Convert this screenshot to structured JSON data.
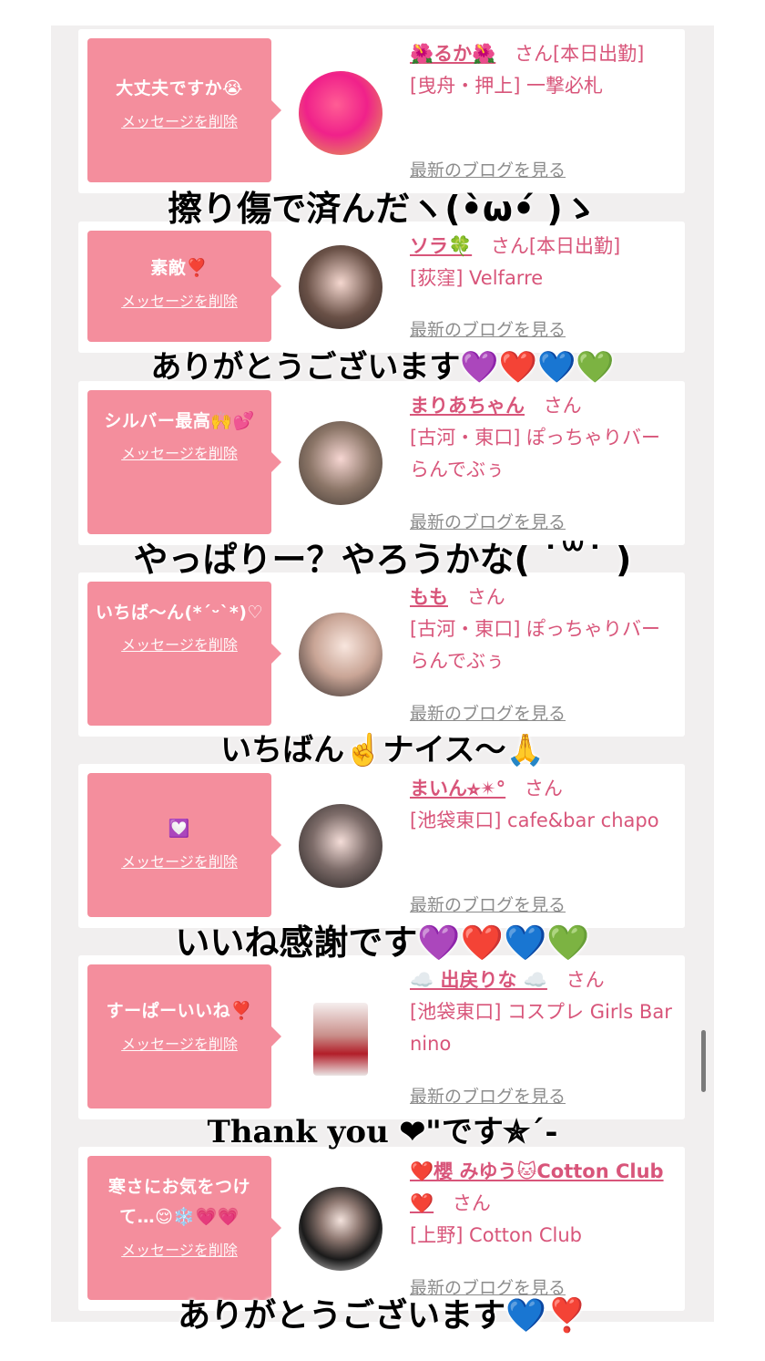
{
  "delete_label": "メッセージを削除",
  "blog_label": "最新のブログを見る",
  "san": "さん",
  "entries": [
    {
      "message": "大丈夫ですか😭",
      "name": "🌺るか🌺",
      "san_line": "さん[本日出勤]",
      "shop": "[曳舟・押上] 一撃必札",
      "caption": "擦り傷で済んだヽ(•̀ω•́ )ゝ"
    },
    {
      "message": "素敵❣️",
      "name": "ソラ🍀",
      "san_line": "さん[本日出勤]",
      "shop": "[荻窪] Velfarre",
      "caption": "ありがとうございます💜❤️💙💚"
    },
    {
      "message": "シルバー最高🙌💕",
      "name": "まりあちゃん",
      "san_line": "さん",
      "shop": "[古河・東口] ぽっちゃりバー らんでぶぅ",
      "caption": "やっぱりー？やろうかな( ˙꒳˙ )"
    },
    {
      "message": "いちば〜ん(*´ᵕ`*)♡",
      "name": "もも",
      "san_line": "さん",
      "shop": "[古河・東口] ぽっちゃりバー らんでぶぅ",
      "caption": "いちばん☝️ナイス〜🙏"
    },
    {
      "message": "💟",
      "name": "まいん⭐︎✴︎°",
      "san_line": "さん",
      "shop": "[池袋東口] cafe&bar chapo",
      "caption": "いいね感謝です💜❤️💙💚"
    },
    {
      "message": "すーぱーいいね❣️",
      "name": "☁️ 出戻りな ☁️",
      "san_line": "さん",
      "shop": "[池袋東口] コスプレ Girls Bar nino",
      "caption": "Thank you ❤︎\"です✯´-"
    },
    {
      "message": "寒さにお気をつけて…😌❄️💗💗",
      "name": "❤️櫻 みゆう🐱Cotton Club❤️",
      "san_line": "さん",
      "shop": "[上野] Cotton Club",
      "caption": "ありがとうございます💙❣️"
    }
  ],
  "colors": {
    "bubble": "#f48e9d",
    "accent": "#d8557a",
    "muted": "#8c8c8c"
  }
}
